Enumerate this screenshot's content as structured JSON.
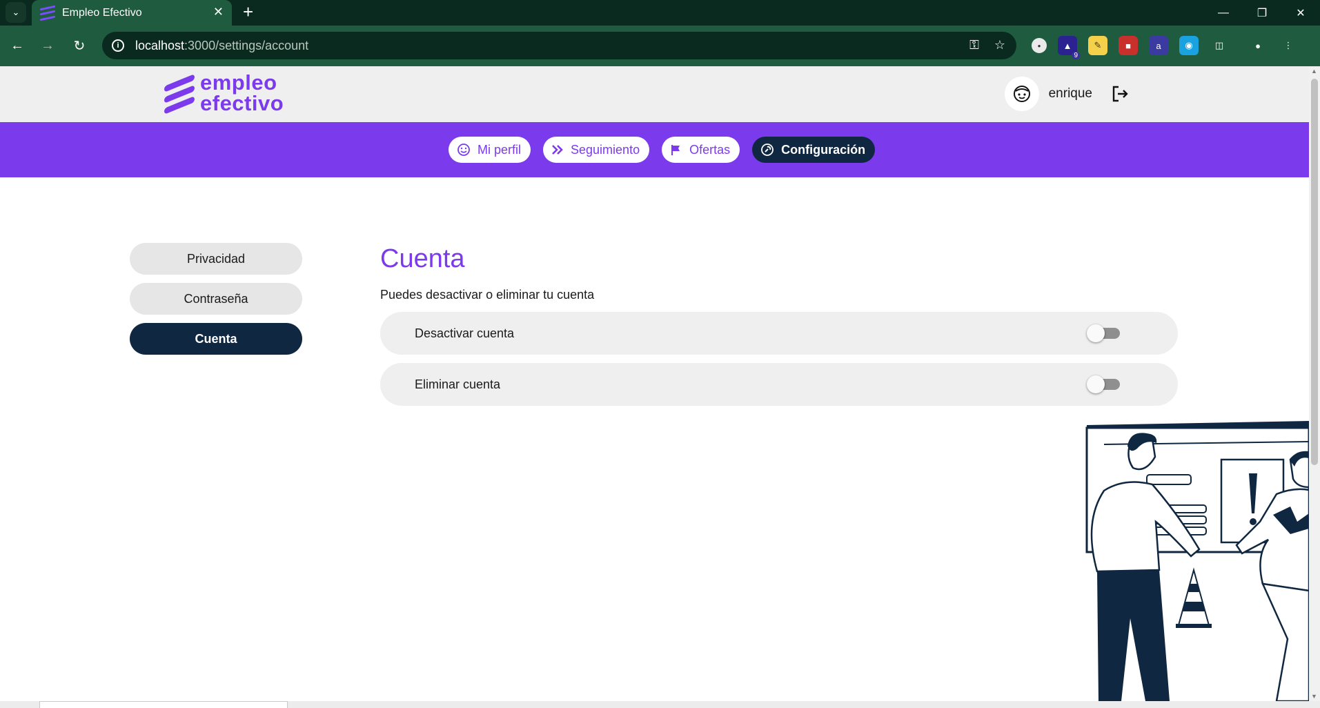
{
  "browser": {
    "tab_title": "Empleo Efectivo",
    "url_host": "localhost",
    "url_path": ":3000/settings/account",
    "extension_badge": "9"
  },
  "header": {
    "logo_line1": "empleo",
    "logo_line2": "efectivo",
    "username": "enrique"
  },
  "nav": {
    "items": [
      {
        "label": "Mi perfil",
        "icon": "smile-icon"
      },
      {
        "label": "Seguimiento",
        "icon": "double-chevron-icon"
      },
      {
        "label": "Ofertas",
        "icon": "flag-icon"
      },
      {
        "label": "Configuración",
        "icon": "settings-wrench-icon",
        "active": true
      }
    ]
  },
  "sidebar": {
    "items": [
      {
        "label": "Privacidad"
      },
      {
        "label": "Contraseña"
      },
      {
        "label": "Cuenta",
        "active": true
      }
    ]
  },
  "account": {
    "title": "Cuenta",
    "description": "Puedes desactivar o eliminar tu cuenta",
    "options": [
      {
        "label": "Desactivar cuenta",
        "enabled": false
      },
      {
        "label": "Eliminar cuenta",
        "enabled": false
      }
    ]
  },
  "colors": {
    "brand_purple": "#7c3aed",
    "dark_navy": "#0f2740",
    "browser_green": "#1f5b3f"
  }
}
